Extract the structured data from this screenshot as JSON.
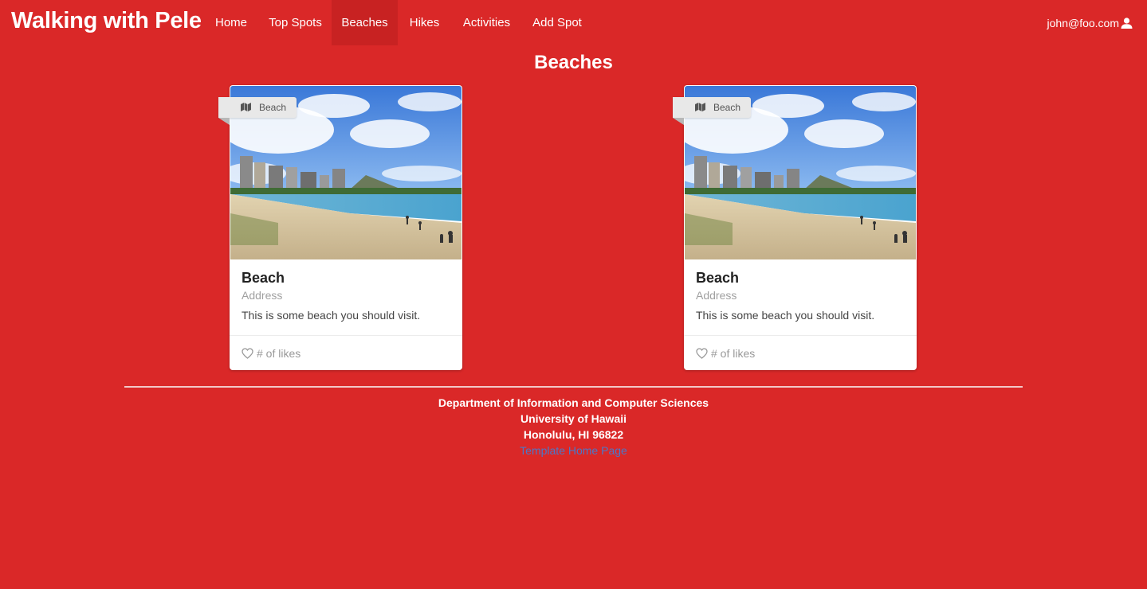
{
  "nav": {
    "brand": "Walking with Pele",
    "items": [
      {
        "label": "Home"
      },
      {
        "label": "Top Spots"
      },
      {
        "label": "Beaches"
      },
      {
        "label": "Hikes"
      },
      {
        "label": "Activities"
      },
      {
        "label": "Add Spot"
      }
    ],
    "active": "Beaches",
    "user": "john@foo.com"
  },
  "page": {
    "title": "Beaches"
  },
  "cards": [
    {
      "ribbon": "Beach",
      "title": "Beach",
      "meta": "Address",
      "description": "This is some beach you should visit.",
      "likes": "# of likes"
    },
    {
      "ribbon": "Beach",
      "title": "Beach",
      "meta": "Address",
      "description": "This is some beach you should visit.",
      "likes": "# of likes"
    }
  ],
  "footer": {
    "line1": "Department of Information and Computer Sciences",
    "line2": "University of Hawaii",
    "line3": "Honolulu, HI 96822",
    "link": "Template Home Page"
  },
  "colors": {
    "background": "#da2828",
    "active_nav": "#c82222",
    "link": "#4a78c8"
  }
}
